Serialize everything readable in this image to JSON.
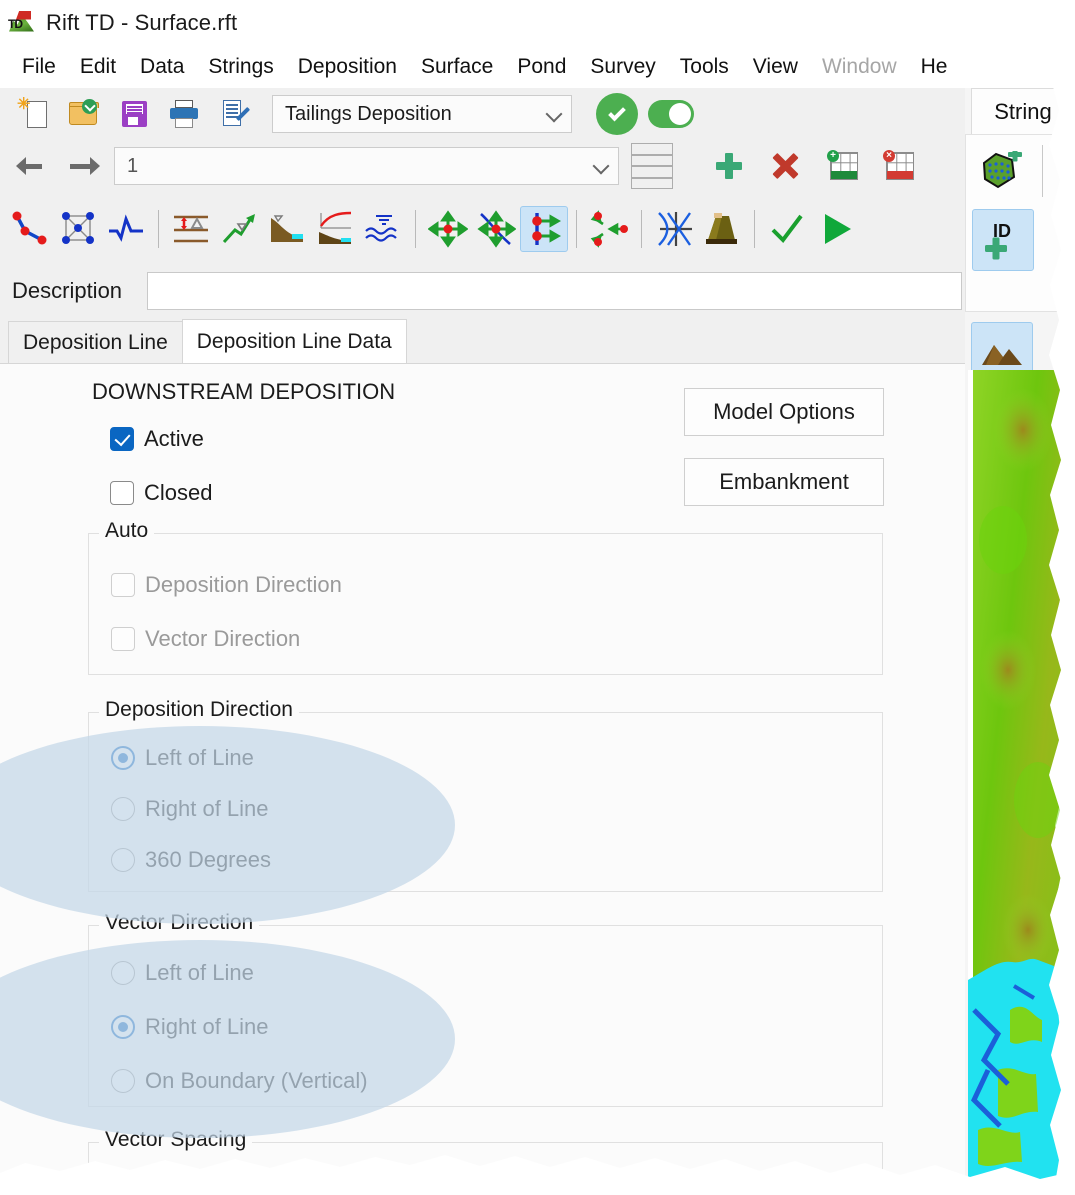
{
  "window": {
    "title": "Rift TD - Surface.rft",
    "icon": "app-logo-icon"
  },
  "menubar": {
    "items": [
      {
        "label": "File",
        "disabled": false
      },
      {
        "label": "Edit",
        "disabled": false
      },
      {
        "label": "Data",
        "disabled": false
      },
      {
        "label": "Strings",
        "disabled": false
      },
      {
        "label": "Deposition",
        "disabled": false
      },
      {
        "label": "Surface",
        "disabled": false
      },
      {
        "label": "Pond",
        "disabled": false
      },
      {
        "label": "Survey",
        "disabled": false
      },
      {
        "label": "Tools",
        "disabled": false
      },
      {
        "label": "View",
        "disabled": false
      },
      {
        "label": "Window",
        "disabled": true
      },
      {
        "label": "He",
        "disabled": false
      }
    ]
  },
  "toolbar_main": {
    "new_tooltip": "New",
    "open_tooltip": "Open",
    "save_tooltip": "Save",
    "print_tooltip": "Print",
    "notes_tooltip": "Edit Notes",
    "mode_select": {
      "value": "Tailings Deposition",
      "options": [
        "Tailings Deposition"
      ]
    },
    "apply_tooltip": "Apply",
    "toggle_state": "on"
  },
  "toolbar_nav": {
    "prev_tooltip": "Previous",
    "next_tooltip": "Next",
    "record_select": {
      "value": "1",
      "options": [
        "1"
      ]
    },
    "spin_up": "▲",
    "spin_down": "▼",
    "add_tooltip": "Add",
    "delete_tooltip": "Delete",
    "insert_row_tooltip": "Insert Row",
    "delete_row_tooltip": "Delete Row"
  },
  "toolbar_tools": {
    "items": [
      {
        "name": "polyline-points-icon",
        "selected": false
      },
      {
        "name": "mesh-nodes-icon",
        "selected": false
      },
      {
        "name": "waveform-icon",
        "selected": false
      },
      {
        "name": "elevation-delta-icon",
        "selected": false
      },
      {
        "name": "slope-arrow-icon",
        "selected": false
      },
      {
        "name": "beach-profile-icon",
        "selected": false
      },
      {
        "name": "curve-profile-icon",
        "selected": false
      },
      {
        "name": "water-waves-icon",
        "selected": false
      },
      {
        "name": "move-4way-icon",
        "selected": false
      },
      {
        "name": "move-curve-4way-icon",
        "selected": false
      },
      {
        "name": "vector-line-arrows-icon",
        "selected": true
      },
      {
        "name": "converge-points-icon",
        "selected": false
      },
      {
        "name": "intersect-lines-icon",
        "selected": false
      },
      {
        "name": "embankment-icon",
        "selected": false
      },
      {
        "name": "confirm-check-icon",
        "selected": false
      },
      {
        "name": "run-play-icon",
        "selected": false
      }
    ]
  },
  "description": {
    "label": "Description",
    "value": "",
    "placeholder": ""
  },
  "tabs": [
    {
      "label": "Deposition Line",
      "active": false
    },
    {
      "label": "Deposition Line Data",
      "active": true
    }
  ],
  "form": {
    "section_title": "DOWNSTREAM DEPOSITION",
    "active": {
      "label": "Active",
      "checked": true,
      "disabled": false
    },
    "closed": {
      "label": "Closed",
      "checked": false,
      "disabled": false
    },
    "model_options_button": "Model Options",
    "embankment_button": "Embankment",
    "auto_group": {
      "legend": "Auto",
      "items": [
        {
          "label": "Deposition Direction",
          "checked": false,
          "disabled": true
        },
        {
          "label": "Vector Direction",
          "checked": false,
          "disabled": true
        }
      ]
    },
    "deposition_direction_group": {
      "legend": "Deposition Direction",
      "selected": "Left of Line",
      "options": [
        "Left of Line",
        "Right of Line",
        "360 Degrees"
      ]
    },
    "vector_direction_group": {
      "legend": "Vector Direction",
      "selected": "Right of Line",
      "options": [
        "Left of Line",
        "Right of Line",
        "On Boundary (Vertical)"
      ]
    },
    "vector_spacing_group": {
      "legend": "Vector Spacing"
    }
  },
  "right_panel": {
    "tab_label": "String",
    "buttons": [
      {
        "name": "add-polygon-icon",
        "selected": false
      },
      {
        "name": "add-id-icon",
        "selected": true
      },
      {
        "name": "terrain-surface-icon",
        "selected": true
      },
      {
        "name": "ruler-point-icon",
        "selected": false
      },
      {
        "name": "flag-marker-icon",
        "selected": false
      },
      {
        "name": "flow-arrows-icon",
        "selected": false
      }
    ]
  },
  "map_preview": {
    "name": "terrain-elevation-map",
    "land_color": "#76c814",
    "water_color": "#21e2f0",
    "high_color": "#8a7a1c",
    "deep_color": "#1b5fd9"
  },
  "colors": {
    "accent_blue": "#0a66c2",
    "selection_blue": "#cce4f7",
    "green": "#4caf50",
    "highlight_ellipse": "#c3d7e8",
    "window_bg": "#f0f0f0",
    "panel_bg": "#fbfbfb"
  }
}
